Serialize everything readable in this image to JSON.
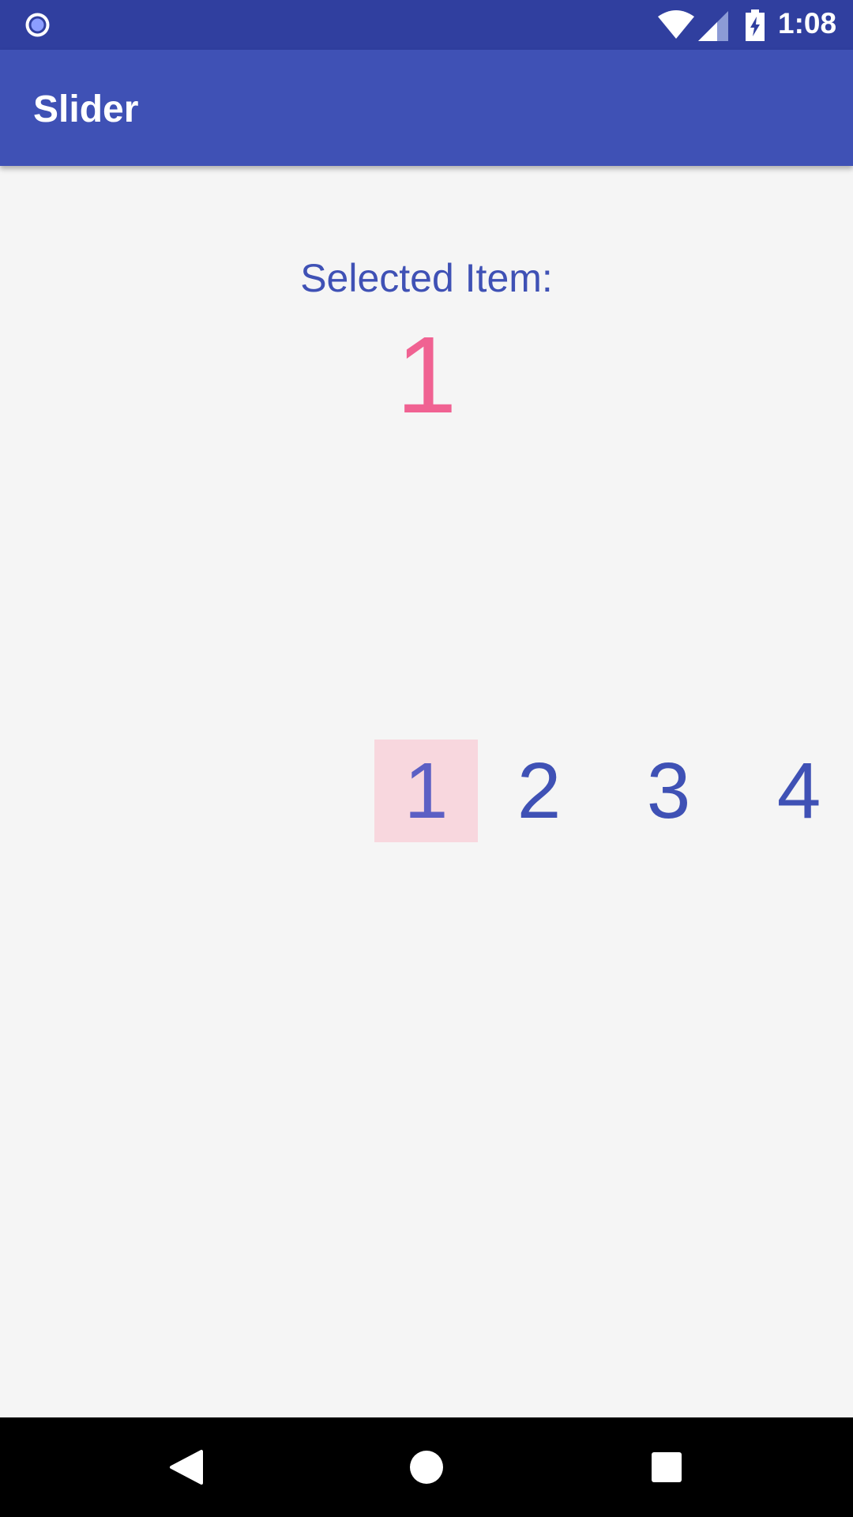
{
  "status_bar": {
    "time": "1:08",
    "icons": [
      "notification-dot-icon",
      "wifi-icon",
      "signal-icon",
      "battery-charging-icon"
    ]
  },
  "app_bar": {
    "title": "Slider"
  },
  "content": {
    "selected_label": "Selected Item:",
    "selected_value": "1",
    "slider_items": [
      "1",
      "2",
      "3",
      "4"
    ],
    "selected_index": 0
  },
  "nav_bar": {
    "icons": [
      "back-icon",
      "home-icon",
      "recents-icon"
    ]
  },
  "colors": {
    "status_bar": "#303f9f",
    "app_bar": "#3f51b5",
    "accent": "#f06292",
    "primary_text": "#3f51b5",
    "selected_bg": "#f8d7de"
  }
}
